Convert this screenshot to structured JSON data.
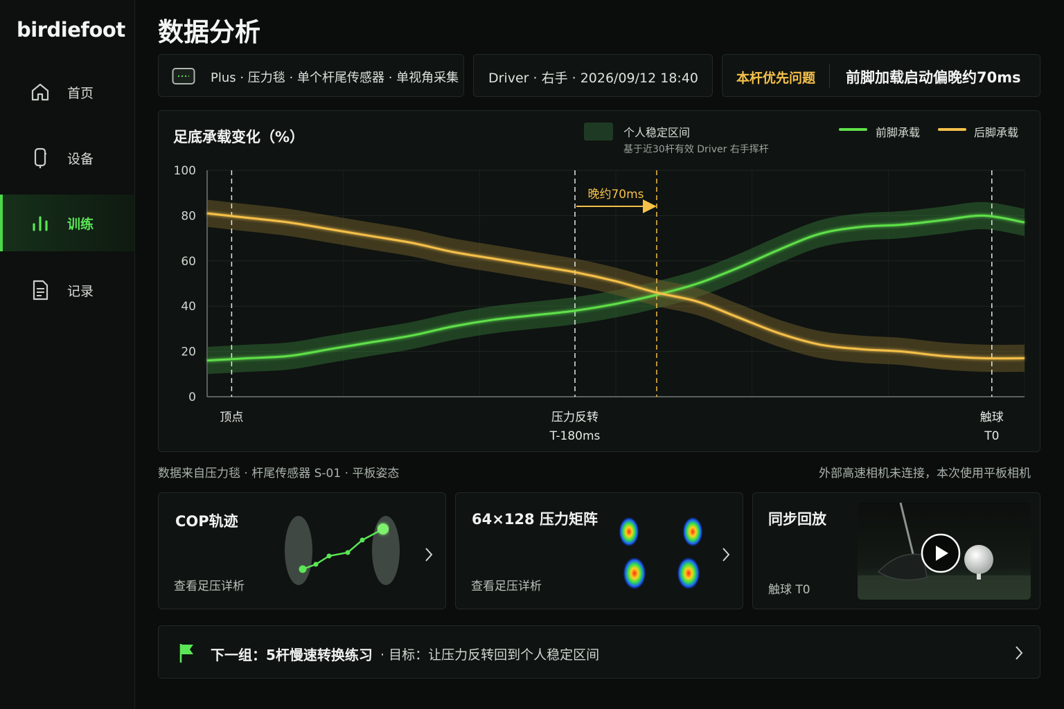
{
  "app": {
    "brand": "birdiefoot"
  },
  "sidebar": {
    "items": [
      {
        "label": "首页",
        "icon": "home-icon",
        "active": false
      },
      {
        "label": "设备",
        "icon": "device-icon",
        "active": false
      },
      {
        "label": "训练",
        "icon": "bar-chart-icon",
        "active": true
      },
      {
        "label": "记录",
        "icon": "document-icon",
        "active": false
      }
    ]
  },
  "page": {
    "title": "数据分析"
  },
  "info_bar": {
    "equipment": "Plus · 压力毯 · 单个杆尾传感器 · 单视角采集",
    "session": "Driver · 右手 · 2026/09/12 18:40",
    "priority_label": "本杆优先问题",
    "priority_value": "前脚加载启动偏晚约70ms"
  },
  "chart_card": {
    "title": "足底承载变化（%）",
    "band_legend": "个人稳定区间",
    "band_note": "基于近30杆有效 Driver 右手挥杆",
    "annotation": "晚约70ms",
    "phases": [
      {
        "label": "顶点",
        "sub": ""
      },
      {
        "label": "压力反转",
        "sub": "T-180ms"
      },
      {
        "label": "触球",
        "sub": "T0"
      }
    ]
  },
  "chart_data": {
    "type": "line",
    "ylim": [
      0,
      100
    ],
    "yticks": [
      "0",
      "20",
      "40",
      "60",
      "80",
      "100"
    ],
    "x": [
      0,
      5,
      10,
      15,
      20,
      25,
      30,
      35,
      40,
      45,
      50,
      55,
      60,
      65,
      70,
      75,
      80,
      85,
      90,
      95,
      100
    ],
    "series": [
      {
        "name": "前脚承载",
        "color": "#5fe04a",
        "values": [
          16,
          17,
          18,
          21,
          24,
          27,
          31,
          34,
          36,
          38,
          41,
          45,
          50,
          57,
          65,
          72,
          75,
          76,
          78,
          80,
          77
        ]
      },
      {
        "name": "后脚承载",
        "color": "#f5c04a",
        "values": [
          81,
          79,
          77,
          74,
          71,
          68,
          64,
          61,
          58,
          55,
          51,
          46,
          42,
          35,
          28,
          23,
          21,
          20,
          18,
          17,
          17
        ]
      }
    ],
    "bands": [
      {
        "center": [
          16,
          17,
          18,
          21,
          24,
          27,
          31,
          34,
          36,
          38,
          41,
          45,
          50,
          57,
          65,
          72,
          75,
          76,
          78,
          80,
          77
        ],
        "halfwidth": 6,
        "color": "#2f6a33"
      },
      {
        "center": [
          81,
          79,
          77,
          74,
          71,
          68,
          64,
          61,
          58,
          55,
          51,
          46,
          42,
          35,
          28,
          23,
          21,
          20,
          18,
          17,
          17
        ],
        "halfwidth": 6,
        "color": "#6a5a2a"
      }
    ],
    "markers_x": [
      3,
      45,
      55,
      96
    ]
  },
  "footnotes": {
    "left": "数据来自压力毯 · 杆尾传感器 S-01 · 平板姿态",
    "right": "外部高速相机未连接，本次使用平板相机"
  },
  "cards": {
    "cop": {
      "title": "COP轨迹",
      "sub": "查看足压详析"
    },
    "matrix": {
      "title": "64×128 压力矩阵",
      "sub": "查看足压详析"
    },
    "replay": {
      "title": "同步回放",
      "sub": "触球 T0"
    }
  },
  "next_set": {
    "title": "下一组：5杆慢速转换练习",
    "goal": "· 目标：让压力反转回到个人稳定区间"
  }
}
